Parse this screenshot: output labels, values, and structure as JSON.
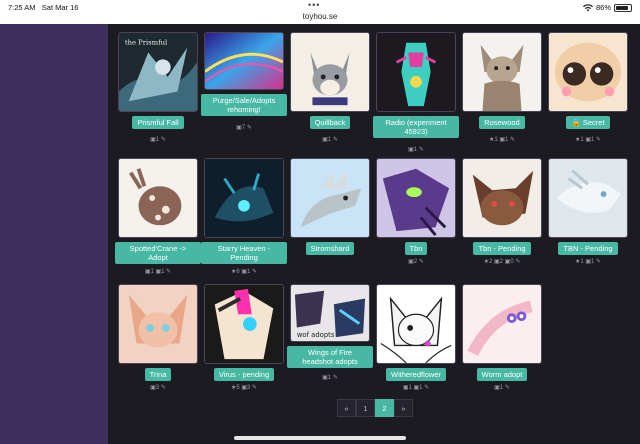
{
  "status_bar": {
    "time": "7:25 AM",
    "date": "Sat Mar 16",
    "url": "toyhou.se",
    "battery": "86%",
    "battery_level": 0.86,
    "dots": "•••"
  },
  "characters": [
    {
      "name": "Prismful Fall",
      "stats": "▣1 ✎"
    },
    {
      "name": "Purge/Sale/Adopts rehoming!",
      "stats": "▣7 ✎"
    },
    {
      "name": "Quillback",
      "stats": "▣1 ✎"
    },
    {
      "name": "Radio (experiment 45923)",
      "stats": "▣1 ✎"
    },
    {
      "name": "Rosewood",
      "stats": "★1 ▣1 ✎"
    },
    {
      "name": "Secret",
      "stats": "★1 ▣1 ✎"
    },
    {
      "name": "Spotted'Crane -> Adopt",
      "stats": "▣1 ▣1 ✎"
    },
    {
      "name": "Starry Heaven - Pending",
      "stats": "★6 ▣1 ✎"
    },
    {
      "name": "Stromshard",
      "stats": "▣1 ✎"
    },
    {
      "name": "Tbn",
      "stats": "▣2 ✎"
    },
    {
      "name": "Tbn - Pending",
      "stats": "★2 ▣2 ▣0 ✎"
    },
    {
      "name": "TBN - Pending",
      "stats": "★1 ▣1 ✎"
    },
    {
      "name": "Trina",
      "stats": "▣3 ✎"
    },
    {
      "name": "Virus - pending",
      "stats": "★5 ▣3 ✎"
    },
    {
      "name": "Wings of Fire headshot adopts",
      "stats": "▣1 ✎"
    },
    {
      "name": "Witheredflower",
      "stats": "▣1 ▣1 ✎"
    },
    {
      "name": "Worm adopt",
      "stats": "▣1 ✎"
    }
  ],
  "pagination": {
    "prev": "«",
    "pages": [
      "1",
      "2"
    ],
    "active": "2",
    "next": "»"
  },
  "secret_icon": "lock-icon",
  "thumb_text": {
    "wof_adopts": "wof adopts",
    "prismful": "the Prismful"
  },
  "colors": {
    "accent": "#46b8a4",
    "sidebar": "#3d2f5e",
    "background": "#1c1b22"
  }
}
